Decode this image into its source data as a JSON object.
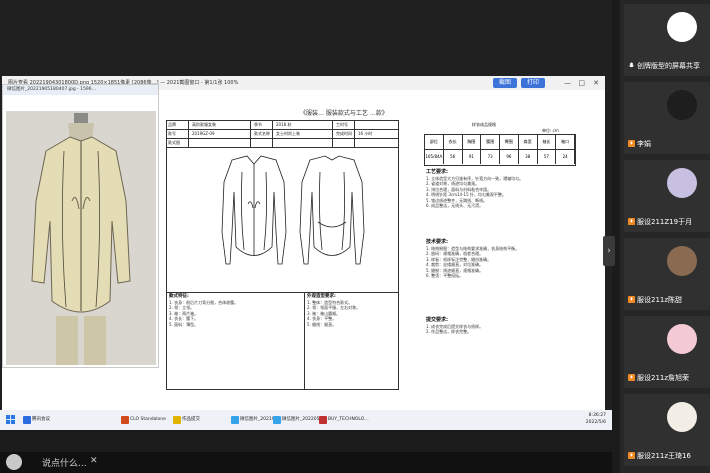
{
  "viewer": {
    "title": "图片查看 20221904301800D.png  1520×1851像素  [2086像…]  — 2021截图窗口 - 第1/1张 100%",
    "btn_edit": "截图",
    "btn_print": "打印"
  },
  "image_window": {
    "title": "微信图片_20221905180407.jpg - 1596…"
  },
  "document": {
    "title": "《服装…  服装款式与工艺  …款》",
    "labels": {
      "name_label": "品牌",
      "name_value": "高阶款服女装",
      "season_label": "季节",
      "season_value": "2018 秋",
      "process_label": "工时号",
      "no_label": "款号",
      "no_value": "2019GZ-09",
      "style_label": "款式名称",
      "style_value": "女士时尚上装",
      "time_label": "完成时间",
      "time_value": "16 小时",
      "drawing_label": "款式图",
      "size_title": "样衣成品规格",
      "unit": "单位: cm",
      "size_headers": [
        "部位",
        "衣长",
        "胸围",
        "腰围",
        "臀围",
        "肩宽",
        "袖长",
        "袖口"
      ],
      "size_row_label": "165/84A",
      "size_values": [
        "56",
        "91",
        "73",
        "96",
        "38",
        "57",
        "24"
      ]
    },
    "process_head": "工艺要求:",
    "process_lines": [
      "1. 立体造型大方归拔有序，针宽方向一致，褶皱均匀。",
      "2. 省道对称，线迹均匀美观。",
      "3. 排位合理，面料与衬料粘合牢固。",
      "4. 明线针距 3cm14-15 针，均匀美观平整。",
      "5. 锁边线迹整齐，无跳线、断线。",
      "6. 成品整洁，无线头、无污渍。"
    ],
    "tech_head": "技术要求:",
    "tech_lines": [
      "1. 结构制图：造型与结构要求准确，衣身结构平衡。",
      "2. 放码：规格准确，档差合理。",
      "3. 样板：纸样标注完整，缝份准确。",
      "4. 裁剪：丝缕顺直，对位准确。",
      "5. 缝制：线迹顺直，规格准确。",
      "6. 整烫：平整挺括。"
    ],
    "finish_head": "提交要求:",
    "finish_lines": [
      "1. 成衣完成后提交样衣与纸样。",
      "2. 作品整洁，样衣完整。"
    ],
    "style_desc_head": "款式特征:",
    "style_desc": [
      "1. 衣身：前后片刀背分割，合体收腰。",
      "2. 领：立领。",
      "3. 袖：两片袖。",
      "4. 衣长：腰下。",
      "5. 面料：薄型。"
    ],
    "quality_head": "外观造型要求:",
    "quality_desc": [
      "1. 整体：造型符合款式。",
      "2. 领：领面平服，左右对称。",
      "3. 袖：袖山圆顺。",
      "4. 衣身：平整。",
      "5. 缝线：顺直。"
    ]
  },
  "taskbar": {
    "items": [
      {
        "label": "腾讯会议",
        "color": "#2d6cdf"
      },
      {
        "label": "CLO Standalone",
        "color": "#d04a1d"
      },
      {
        "label": "作品提交",
        "color": "#e0b400"
      },
      {
        "label": "微信图片_202190…",
        "color": "#35a3e8"
      },
      {
        "label": "微信图片_202205…",
        "color": "#35a3e8"
      },
      {
        "label": "BUY_TECHNOLO…",
        "color": "#c03030"
      }
    ],
    "time": "8:36:27",
    "date": "2022/5/6"
  },
  "chatbar": {
    "placeholder": "说点什么...",
    "close": "✕"
  },
  "participants": [
    {
      "name": "创牌版型的屏幕共享",
      "avatar_color": "#ffffff",
      "mic": true
    },
    {
      "name": "李娟",
      "avatar_color": "#1e1e1e",
      "mic": false
    },
    {
      "name": "服设211Z19于月",
      "avatar_color": "#c8c0e0",
      "mic": false
    },
    {
      "name": "服设211z陈甜",
      "avatar_color": "#8a6a50",
      "mic": false
    },
    {
      "name": "服设211z詹旭荣",
      "avatar_color": "#f3c9d4",
      "mic": false
    },
    {
      "name": "服设211z王琦16",
      "avatar_color": "#f2eee5",
      "mic": false
    }
  ],
  "side_toggle": "›"
}
